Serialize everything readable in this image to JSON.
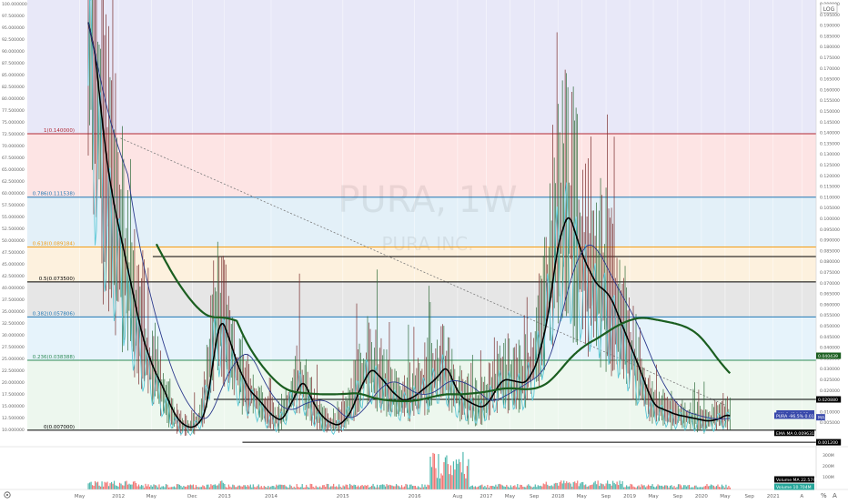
{
  "ui": {
    "watermark_symbol": "PURA, 1W",
    "watermark_name": "PURA INC.",
    "log_button": "LOG",
    "bottom_left_icon": "settings-icon",
    "bottom_right_labels": [
      "%",
      "A"
    ]
  },
  "chart_data": {
    "type": "line",
    "title": "",
    "xlabel": "",
    "ylabel": "",
    "xlim": [
      2011.6,
      2022.6
    ],
    "ylim": [
      0,
      0.2
    ],
    "x_ticks": [
      {
        "label": "May",
        "x": 2012.33
      },
      {
        "label": "2012",
        "x": 2012.87
      },
      {
        "label": "May",
        "x": 2013.33
      },
      {
        "label": "Dec",
        "x": 2013.9
      },
      {
        "label": "2013",
        "x": 2014.35
      },
      {
        "label": "2014",
        "x": 2015.0
      },
      {
        "label": "2015",
        "x": 2016.0
      },
      {
        "label": "2016",
        "x": 2017.0
      },
      {
        "label": "Aug",
        "x": 2017.6
      },
      {
        "label": "2017",
        "x": 2018.0
      },
      {
        "label": "May",
        "x": 2018.33
      },
      {
        "label": "Sep",
        "x": 2018.67
      },
      {
        "label": "2018",
        "x": 2019.0
      },
      {
        "label": "May",
        "x": 2019.33
      },
      {
        "label": "Sep",
        "x": 2019.67
      },
      {
        "label": "2019",
        "x": 2020.0
      },
      {
        "label": "May",
        "x": 2020.33
      },
      {
        "label": "Sep",
        "x": 2020.67
      },
      {
        "label": "2020",
        "x": 2021.0
      },
      {
        "label": "May",
        "x": 2021.33
      },
      {
        "label": "Sep",
        "x": 2021.67
      },
      {
        "label": "2021",
        "x": 2022.0
      },
      {
        "label": "A",
        "x": 2022.4
      }
    ],
    "left_axis_ticks": [
      "100.000000",
      "97.500000",
      "95.000000",
      "92.500000",
      "90.000000",
      "87.500000",
      "85.000000",
      "82.500000",
      "80.000000",
      "77.500000",
      "75.000000",
      "72.500000",
      "70.000000",
      "67.500000",
      "65.000000",
      "62.500000",
      "60.000000",
      "57.500000",
      "55.000000",
      "52.500000",
      "50.000000",
      "47.500000",
      "45.000000",
      "42.500000",
      "40.000000",
      "37.500000",
      "35.000000",
      "32.500000",
      "30.000000",
      "27.500000",
      "25.000000",
      "22.500000",
      "20.000000",
      "17.500000",
      "15.000000",
      "12.500000",
      "10.000000"
    ],
    "right_axis_ticks": [
      "0.200000",
      "0.195000",
      "0.190000",
      "0.185000",
      "0.180000",
      "0.175000",
      "0.170000",
      "0.165000",
      "0.160000",
      "0.155000",
      "0.150000",
      "0.145000",
      "0.140000",
      "0.135000",
      "0.130000",
      "0.125000",
      "0.120000",
      "0.115000",
      "0.110000",
      "0.105000",
      "0.100000",
      "0.095000",
      "0.090000",
      "0.085000",
      "0.080000",
      "0.075000",
      "0.070000",
      "0.065000",
      "0.060000",
      "0.055000",
      "0.050000",
      "0.045000",
      "0.040000",
      "0.035000",
      "0.030000",
      "0.025000",
      "0.020000",
      "0.015000",
      "0.010000",
      "0.005000"
    ],
    "fib_levels": [
      {
        "label": "1(0.140000)",
        "value": 0.14,
        "color": "#b22833",
        "zone_above": "#e8e8f8"
      },
      {
        "label": "0.786(0.111538)",
        "value": 0.111538,
        "color": "#1f77b4",
        "zone_above": "#fde4e4"
      },
      {
        "label": "0.618(0.089184)",
        "value": 0.089184,
        "color": "#f39c12",
        "zone_above": "#e3f0f8"
      },
      {
        "label": "0.5(0.073500)",
        "value": 0.0735,
        "color": "#000000",
        "zone_above": "#fdf1de"
      },
      {
        "label": "0.382(0.057806)",
        "value": 0.057806,
        "color": "#1f77b4",
        "zone_above": "#e6e6e6"
      },
      {
        "label": "0.236(0.038388)",
        "value": 0.038388,
        "color": "#2e8b57",
        "zone_above": "#e6f3fb"
      },
      {
        "label": "0(0.007000)",
        "value": 0.007,
        "color": "#000000",
        "zone_above": "#edf7ee"
      }
    ],
    "horizontal_lines": [
      {
        "value": 0.0849,
        "x_start": 2013.35,
        "label": "0.084996"
      },
      {
        "value": 0.0208,
        "x_start": 2014.2,
        "label": "0.020880"
      },
      {
        "value": 0.0016,
        "x_start": 2014.6,
        "label": "0.001200"
      }
    ],
    "trendline": {
      "x": [
        2012.9,
        2021.35
      ],
      "y": [
        0.138,
        0.018
      ]
    },
    "price_series": {
      "name": "PURA",
      "x": [
        2012.45,
        2012.55,
        2012.65,
        2012.75,
        2012.85,
        2012.95,
        2013.05,
        2013.15,
        2013.25,
        2013.35,
        2013.45,
        2013.55,
        2013.65,
        2013.75,
        2013.85,
        2013.95,
        2014.05,
        2014.15,
        2014.25,
        2014.35,
        2014.5,
        2014.65,
        2014.8,
        2014.95,
        2015.1,
        2015.25,
        2015.4,
        2015.5,
        2015.6,
        2015.7,
        2015.8,
        2015.9,
        2016.05,
        2016.2,
        2016.35,
        2016.5,
        2016.65,
        2016.8,
        2016.95,
        2017.1,
        2017.25,
        2017.4,
        2017.5,
        2017.6,
        2017.75,
        2017.9,
        2018.0,
        2018.1,
        2018.2,
        2018.35,
        2018.5,
        2018.65,
        2018.8,
        2018.95,
        2019.1,
        2019.2,
        2019.3,
        2019.4,
        2019.5,
        2019.6,
        2019.7,
        2019.8,
        2019.9,
        2020.0,
        2020.1,
        2020.2,
        2020.3,
        2020.45,
        2020.6,
        2020.75,
        2020.9,
        2021.05,
        2021.2,
        2021.3,
        2021.4
      ],
      "y": [
        0.19,
        0.16,
        0.13,
        0.11,
        0.095,
        0.08,
        0.065,
        0.05,
        0.04,
        0.032,
        0.026,
        0.018,
        0.012,
        0.009,
        0.008,
        0.01,
        0.016,
        0.04,
        0.058,
        0.05,
        0.035,
        0.025,
        0.02,
        0.014,
        0.011,
        0.02,
        0.03,
        0.022,
        0.016,
        0.012,
        0.01,
        0.009,
        0.014,
        0.026,
        0.035,
        0.03,
        0.024,
        0.02,
        0.022,
        0.026,
        0.03,
        0.036,
        0.028,
        0.022,
        0.019,
        0.017,
        0.02,
        0.026,
        0.03,
        0.029,
        0.028,
        0.036,
        0.055,
        0.09,
        0.105,
        0.095,
        0.085,
        0.078,
        0.072,
        0.07,
        0.066,
        0.058,
        0.05,
        0.042,
        0.034,
        0.025,
        0.018,
        0.016,
        0.014,
        0.013,
        0.012,
        0.011,
        0.012,
        0.014,
        0.013
      ]
    },
    "annotations": [
      {
        "text": "0.040439",
        "value": 0.0404,
        "bg": "#1b5e20"
      },
      {
        "text": "0.020880",
        "value": 0.0208,
        "bg": "#000000"
      },
      {
        "text": "MA 1.414 0.12",
        "value": 0.0145,
        "bg": "#3949ab"
      },
      {
        "text": "PURA -96.5% 0.013000",
        "value": 0.0135,
        "bg": "#3949ab"
      },
      {
        "text": "MA",
        "value": 0.0128,
        "bg": "#3949ab"
      },
      {
        "text": "EMA MA 0.009631",
        "value": 0.0058,
        "bg": "#000000"
      },
      {
        "text": "0.001200",
        "value": 0.0016,
        "bg": "#000000"
      },
      {
        "text": "Volume MA 22.574M",
        "value": null,
        "bg": "#000000"
      },
      {
        "text": "Volume 10.704M",
        "value": null,
        "bg": "#26a69a"
      }
    ],
    "volume_axis_ticks": [
      "300M",
      "200M",
      "100M"
    ],
    "colors": {
      "up": "#26a69a",
      "down": "#ef5350",
      "price_bars": "#2f6b3a",
      "ma_black": "#000000",
      "ma_blue": "#2b3a8c",
      "ma_cyan": "#5bc8d6",
      "ma_green": "#1b5e20"
    }
  }
}
